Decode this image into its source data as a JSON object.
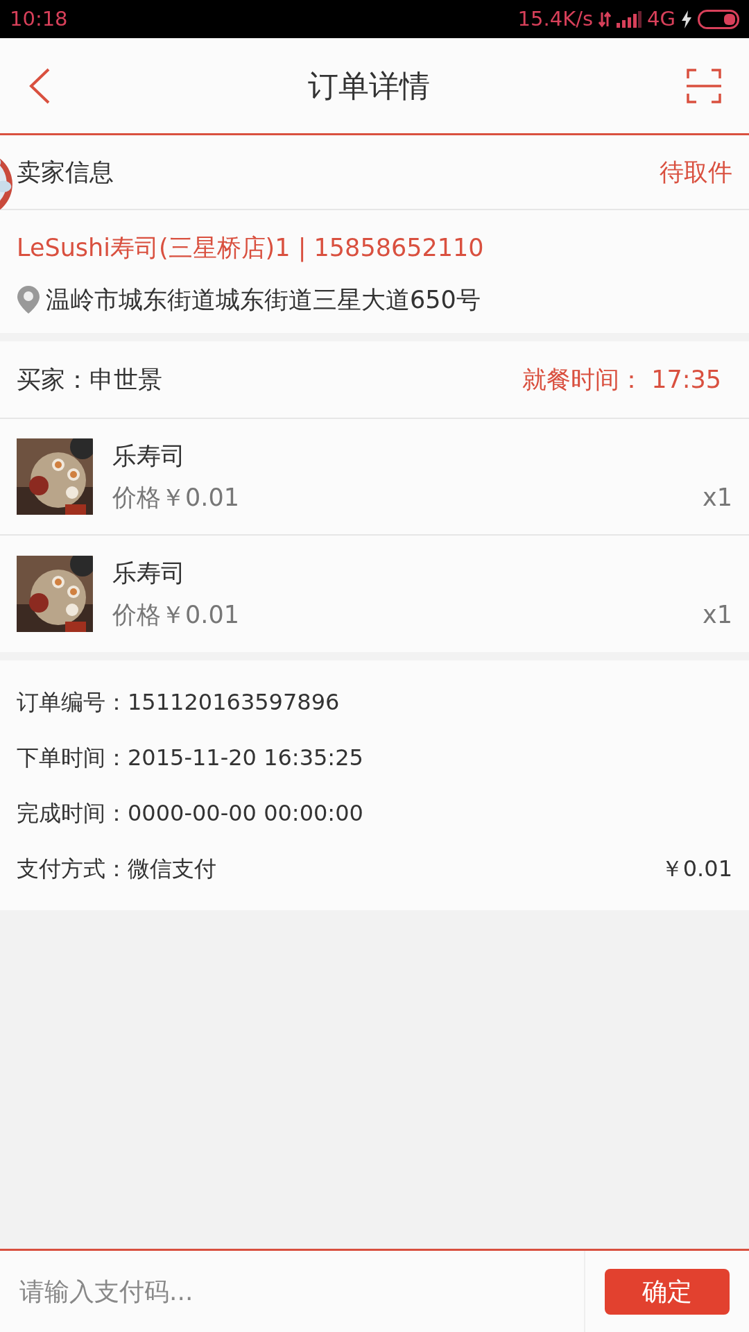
{
  "status_bar": {
    "time": "10:18",
    "speed": "15.4K/s",
    "network": "4G"
  },
  "header": {
    "title": "订单详情"
  },
  "seller": {
    "heading": "卖家信息",
    "status": "待取件",
    "name_phone": "LeSushi寿司(三星桥店)1 | 15858652110",
    "address": "温岭市城东街道城东街道三星大道650号"
  },
  "buyer": {
    "label": "买家：申世景",
    "meal_time": "就餐时间： 17:35"
  },
  "items": [
    {
      "name": "乐寿司",
      "price": "价格￥0.01",
      "quantity": "x1"
    },
    {
      "name": "乐寿司",
      "price": "价格￥0.01",
      "quantity": "x1"
    }
  ],
  "order_info": [
    {
      "text": "订单编号：151120163597896"
    },
    {
      "text": "下单时间：2015-11-20 16:35:25"
    },
    {
      "text": "完成时间：0000-00-00 00:00:00"
    },
    {
      "text": "支付方式：微信支付",
      "amount": "￥0.01"
    }
  ],
  "payment": {
    "placeholder": "请输入支付码...",
    "button": "确定"
  }
}
